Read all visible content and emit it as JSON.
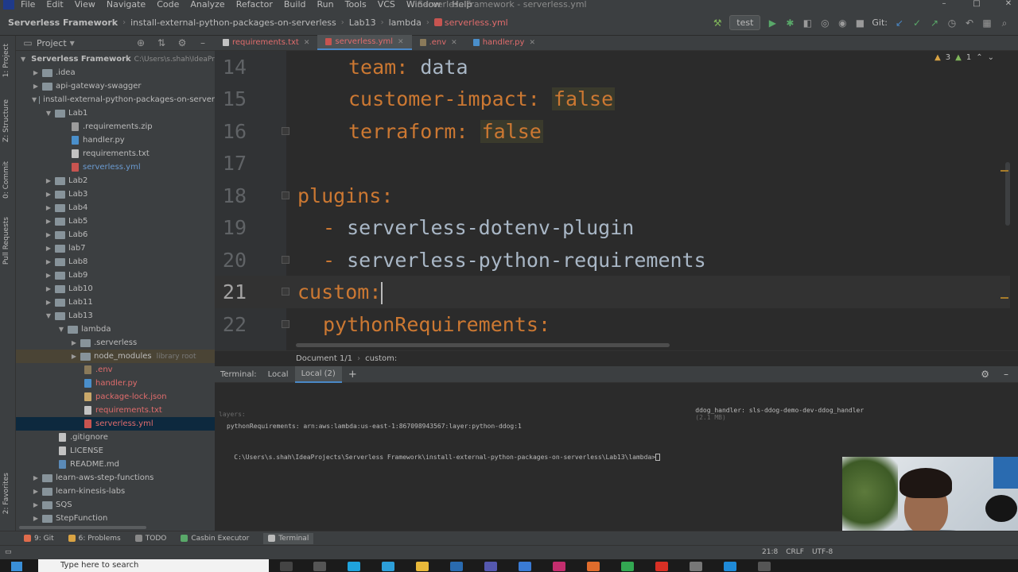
{
  "menubar": {
    "items": [
      "File",
      "Edit",
      "View",
      "Navigate",
      "Code",
      "Analyze",
      "Refactor",
      "Build",
      "Run",
      "Tools",
      "VCS",
      "Window",
      "Help"
    ],
    "window_title": "Serverless Framework - serverless.yml"
  },
  "navbar": {
    "crumbs": [
      "Serverless Framework",
      "install-external-python-packages-on-serverless",
      "Lab13",
      "lambda",
      "serverless.yml"
    ],
    "run_config": "test",
    "git_label": "Git:"
  },
  "left_strip": {
    "tabs": [
      "1: Project",
      "Z: Structure",
      "0: Commit",
      "Pull Requests",
      "2: Favorites"
    ]
  },
  "project": {
    "title": "Project",
    "root_label": "Serverless Framework",
    "root_path": "C:\\Users\\s.shah\\IdeaProjects",
    "library_root": "library root",
    "rows": [
      ".idea",
      "api-gateway-swagger",
      "install-external-python-packages-on-server",
      "Lab1",
      ".requirements.zip",
      "handler.py",
      "requirements.txt",
      "serverless.yml",
      "Lab2",
      "Lab3",
      "Lab4",
      "Lab5",
      "Lab6",
      "lab7",
      "Lab8",
      "Lab9",
      "Lab10",
      "Lab11",
      "Lab13",
      "lambda",
      ".serverless",
      "node_modules",
      ".env",
      "handler.py",
      "package-lock.json",
      "requirements.txt",
      "serverless.yml",
      ".gitignore",
      "LICENSE",
      "README.md",
      "learn-aws-step-functions",
      "learn-kinesis-labs",
      "SQS",
      "StepFunction"
    ]
  },
  "editor_tabs": [
    {
      "label": "requirements.txt",
      "active": false
    },
    {
      "label": "serverless.yml",
      "active": true
    },
    {
      "label": ".env",
      "active": false
    },
    {
      "label": "handler.py",
      "active": false
    }
  ],
  "editor": {
    "warnings": "3",
    "errors": "1",
    "lines": [
      {
        "num": "14",
        "key": "team",
        "value": "data"
      },
      {
        "num": "15",
        "key": "customer-impact",
        "value": "false"
      },
      {
        "num": "16",
        "key": "terraform",
        "value": "false"
      },
      {
        "num": "17"
      },
      {
        "num": "18",
        "key": "plugins"
      },
      {
        "num": "19",
        "item": "serverless-dotenv-plugin"
      },
      {
        "num": "20",
        "item": "serverless-python-requirements"
      },
      {
        "num": "21",
        "key": "custom"
      },
      {
        "num": "22",
        "key": "pythonRequirements"
      }
    ]
  },
  "editor_crumb": {
    "doc": "Document 1/1",
    "path": "custom:"
  },
  "terminal": {
    "title": "Terminal:",
    "tabs": [
      "Local",
      "Local (2)"
    ],
    "lines": {
      "handler": "ddog_handler: sls-ddog-demo-dev-ddog_handler",
      "handler_size": "(2.1 MB)",
      "layers": "layers:",
      "python_req": "pythonRequirements: arn:aws:lambda:us-east-1:867098943567:layer:python-ddog:1",
      "prompt": "C:\\Users\\s.shah\\IdeaProjects\\Serverless Framework\\install-external-python-packages-on-serverless\\Lab13\\lambda>"
    }
  },
  "bottom_tools": [
    "9: Git",
    "6: Problems",
    "TODO",
    "Casbin Executor",
    "Terminal"
  ],
  "status": {
    "position": "21:8",
    "line_sep": "CRLF",
    "encoding": "UTF-8"
  },
  "taskbar": {
    "search_placeholder": "Type here to search"
  }
}
